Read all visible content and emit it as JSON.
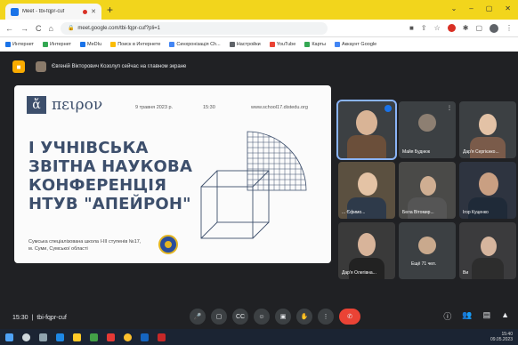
{
  "browser": {
    "tab_title": "Meet - tbi-fqpr-cuf",
    "new_tab": "+",
    "url": "meet.google.com/tbi-fqpr-cuf?pli=1",
    "window_controls": [
      "⌄",
      "–",
      "▢",
      "✕"
    ],
    "bookmarks": [
      {
        "label": "Интернет",
        "color": "#1a73e8"
      },
      {
        "label": "Интернет",
        "color": "#34a853"
      },
      {
        "label": "MeDIu",
        "color": "#1a73e8"
      },
      {
        "label": "Поиск в Интернете",
        "color": "#fbbc04"
      },
      {
        "label": "Синхронізація Ch...",
        "color": "#4285f4"
      },
      {
        "label": "Настройки",
        "color": "#5f6368"
      },
      {
        "label": "YouTube",
        "color": "#ea4335"
      },
      {
        "label": "Карты",
        "color": "#34a853"
      },
      {
        "label": "Аккаунт Google",
        "color": "#4285f4"
      }
    ]
  },
  "meet": {
    "presenter_text": "Євгеній Вікторович Козолуп сейчас на главном экране",
    "meeting_time": "15:30",
    "meeting_code": "tbi-fqpr-cuf",
    "controls": [
      "🎤",
      "▢",
      "CC",
      "☺",
      "▣",
      "✋",
      "⋮",
      "✆"
    ],
    "right_controls": [
      "ⓘ",
      "👥",
      "▤",
      "▲"
    ]
  },
  "slide": {
    "logo_letter": "ἄ",
    "logo_name": "πειρον",
    "date": "9 травня 2023 р.",
    "time": "15:30",
    "site": "www.school17.distedu.org",
    "title": "І УЧНІВСЬКА ЗВІТНА НАУКОВА КОНФЕРЕНЦІЯ НТУВ \"АПЕЙРОН\"",
    "school": "Сумська спеціалізована школа І-ІІІ ступенів №17, м. Суми, Сумської області"
  },
  "participants": [
    {
      "name": "",
      "active": true
    },
    {
      "name": "Майя Буднюк"
    },
    {
      "name": "Дар'я Сергієнко..."
    },
    {
      "name": "... Єфимо..."
    },
    {
      "name": "Бела Вітомир..."
    },
    {
      "name": "Ігор Куценко"
    },
    {
      "name": "Дар'я Олегівна..."
    },
    {
      "name": "Ещё 71 чел."
    },
    {
      "name": "Ви"
    }
  ],
  "taskbar": {
    "clock_time": "15:40",
    "clock_date": "09.05.2023"
  }
}
